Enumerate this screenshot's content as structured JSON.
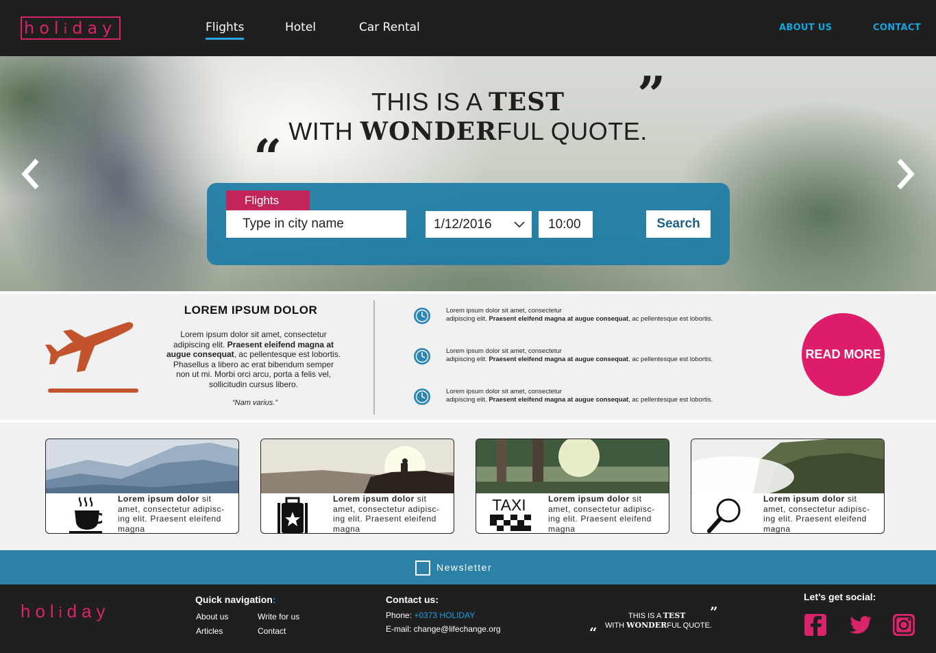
{
  "header": {
    "logo": {
      "pre": "hol",
      "mid": "i",
      "post": "day"
    },
    "nav": [
      "Flights",
      "Hotel",
      "Car Rental"
    ],
    "right_nav": [
      "ABOUT US",
      "CONTACT"
    ]
  },
  "hero": {
    "quote_line1_plain": "THIS IS A ",
    "quote_line1_bold": "TEST",
    "quote_line2_plain_start": "WITH ",
    "quote_line2_bold": "WONDER",
    "quote_line2_plain_end": "FUL QUOTE.",
    "open_mark": "“",
    "close_mark": "”",
    "search": {
      "tab": "Flights",
      "city_placeholder": "Type in city name",
      "date": "1/12/2016",
      "time": "10:00",
      "button": "Search"
    }
  },
  "info": {
    "title": "LOREM IPSUM DOLOR",
    "body_start": "Lorem ipsum dolor sit amet, consectetur adipiscing elit. ",
    "body_bold": "Praesent eleifend magna at augue consequat",
    "body_end": ", ac pellentesque est lobortis. Phasellus a libero ac erat bibendum semper non ut mi. Morbi orci arcu, porta a felis vel, sollicitudin cursus libero.",
    "quote": "“Nam varius.”",
    "features": [
      {
        "line1": "Lorem ipsum dolor sit amet, consectetur",
        "line2_start": "adipiscing elit. ",
        "bold": "Praesent eleifend magna  at augue consequat",
        "line2_end": ", ac pellentesque est  lobortis."
      },
      {
        "line1": "Lorem ipsum dolor sit amet, consectetur",
        "line2_start": "adipiscing elit. ",
        "bold": "Praesent eleifend magna  at augue consequat",
        "line2_end": ", ac pellentesque est  lobortis."
      },
      {
        "line1": "Lorem ipsum dolor sit amet, consectetur",
        "line2_start": "adipiscing elit. ",
        "bold": "Praesent eleifend magna  at augue consequat",
        "line2_end": ", ac pellentesque est  lobortis."
      }
    ],
    "read_more": "READ MORE"
  },
  "cards": [
    {
      "bold": "Lorem ipsum dolor",
      "rest": " sit amet, consectetur adipisc-ing elit. Praesent eleifend magna",
      "icon": "coffee-cup-icon"
    },
    {
      "bold": "Lorem ipsum dolor",
      "rest": " sit amet, consectetur adipisc-ing elit. Praesent eleifend magna",
      "icon": "suitcase-icon"
    },
    {
      "bold": "Lorem ipsum dolor",
      "rest": " sit amet, consectetur adipisc-ing elit. Praesent eleifend magna",
      "icon": "taxi-icon",
      "icon_text": "TAXI"
    },
    {
      "bold": "Lorem ipsum dolor",
      "rest": " sit amet, consectetur adipisc-ing elit. Praesent eleifend magna",
      "icon": "magnifier-icon"
    }
  ],
  "newsletter": {
    "label": "Newsletter"
  },
  "footer": {
    "logo": {
      "pre": "hol",
      "mid": "i",
      "post": "day"
    },
    "quick_nav_title": "Quick navigation",
    "quick_nav_colon": ":",
    "links": [
      "About us",
      "Write for us",
      "Articles",
      "Contact"
    ],
    "contact_title": "Contact us:",
    "phone_label": "Phone: ",
    "phone": "+0373 HOLIDAY",
    "email_label": "E-mail: ",
    "email": "change@lifechange.org",
    "mini_quote_l1_plain": "THIS IS A ",
    "mini_quote_l1_bold": "TEST",
    "mini_quote_l2_plain_start": "WITH ",
    "mini_quote_l2_bold": "WONDER",
    "mini_quote_l2_plain_end": "FUL QUOTE.",
    "open_mark": "“",
    "close_mark": "”",
    "social_title": "Let’s get social:"
  },
  "colors": {
    "brand_pink": "#d9246a",
    "accent_blue": "#16a3e0",
    "panel_blue": "#1d7ca5",
    "plane_orange": "#c3532c",
    "read_more_pink": "#dd1d69"
  }
}
